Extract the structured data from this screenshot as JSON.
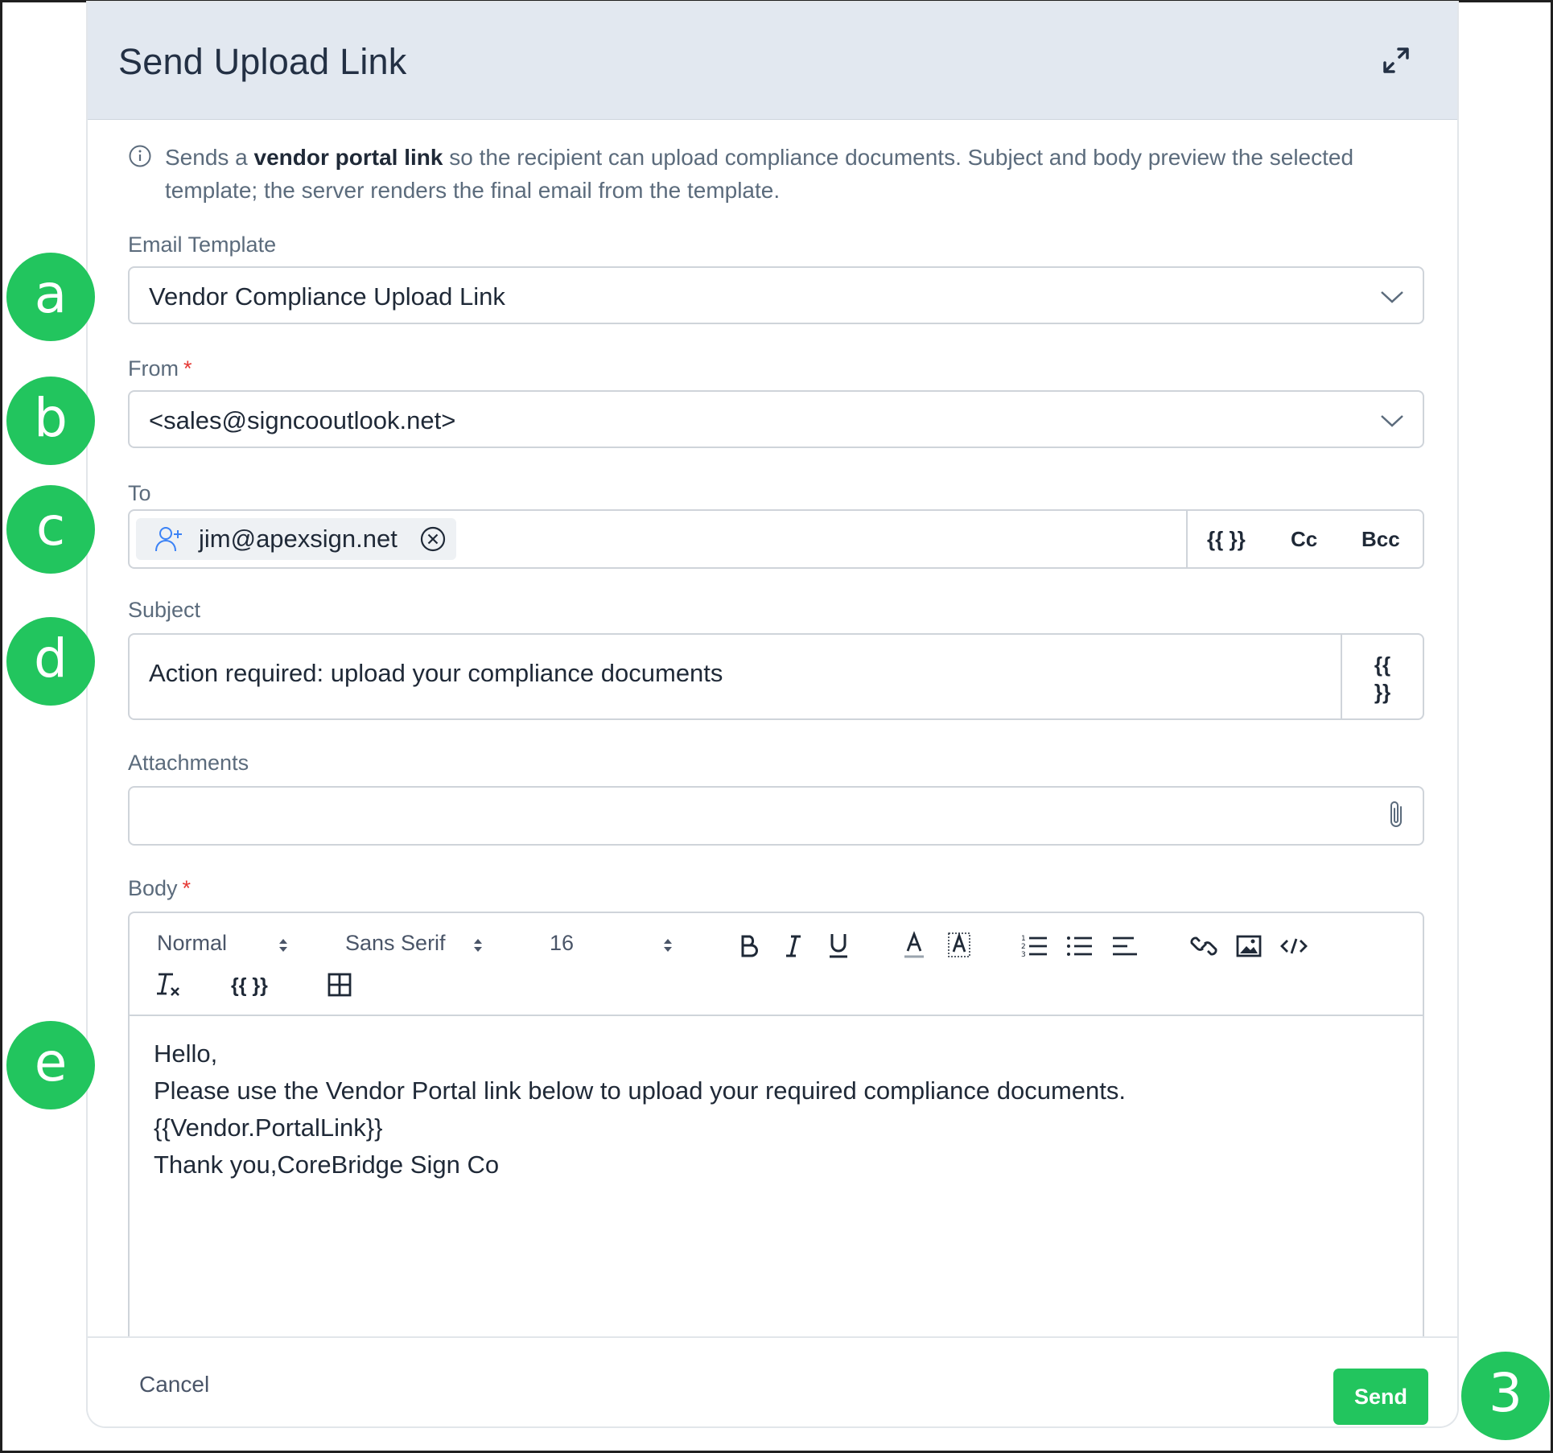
{
  "modal": {
    "title": "Send Upload Link",
    "info_prefix": "Sends a ",
    "info_bold": "vendor portal link",
    "info_suffix": " so the recipient can upload compliance documents. Subject and body preview the selected template; the server renders the final email from the template."
  },
  "email_template": {
    "label": "Email Template",
    "value": "Vendor Compliance Upload Link"
  },
  "from": {
    "label": "From",
    "required_mark": "*",
    "value": "<sales@signcooutlook.net>"
  },
  "to": {
    "label": "To",
    "recipient": "jim@apexsign.net",
    "variables_button": "{{ }}",
    "cc_button": "Cc",
    "bcc_button": "Bcc"
  },
  "subject": {
    "label": "Subject",
    "value": "Action required: upload your compliance documents",
    "variables_button_line1": "{{",
    "variables_button_line2": "}}"
  },
  "attachments": {
    "label": "Attachments"
  },
  "body": {
    "label": "Body",
    "required_mark": "*",
    "toolbar": {
      "heading": "Normal",
      "font": "Sans Serif",
      "size": "16",
      "variables": "{{ }}"
    },
    "lines": [
      "Hello,",
      "Please use the Vendor Portal link below to upload your required compliance documents.",
      "{{Vendor.PortalLink}}",
      "Thank you,CoreBridge Sign Co"
    ]
  },
  "footer": {
    "cancel": "Cancel",
    "send": "Send"
  },
  "callouts": [
    "a",
    "b",
    "c",
    "d",
    "e",
    "3"
  ],
  "colors": {
    "accent": "#22c55e",
    "header_bg": "#e2e8f0",
    "required": "#e53935"
  }
}
